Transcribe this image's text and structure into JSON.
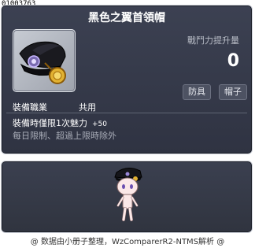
{
  "item_id": "01003763",
  "title": "黑色之翼首領帽",
  "power": {
    "label": "戰鬥力提升量",
    "value": "0"
  },
  "tags": [
    "防具",
    "帽子"
  ],
  "job": {
    "label": "裝備職業",
    "value": "共用"
  },
  "stat_text": "裝備時僅限1次魅力",
  "stat_plus": "+50",
  "limit_text": "每日限制、超過上限時除外",
  "footer": "@ 数据由小册子整理，WzComparerR2-NTMS解析 @",
  "icons": {
    "item": "black-wing-captain-hat-icon",
    "character": "character-preview"
  }
}
